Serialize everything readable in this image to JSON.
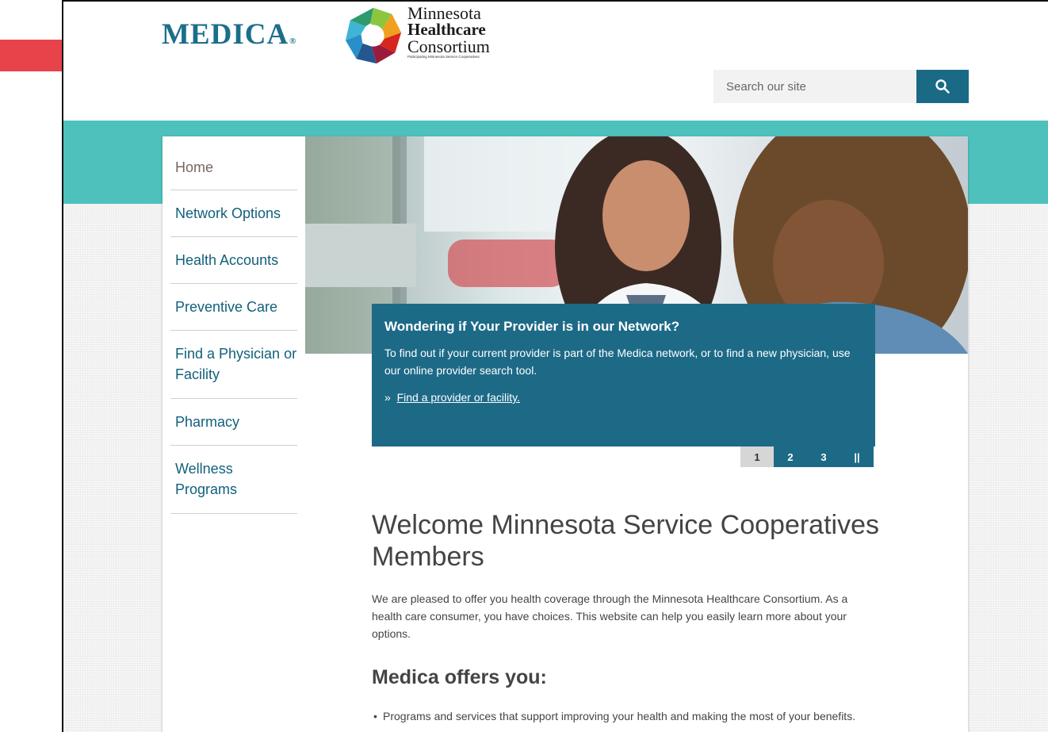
{
  "annotation": {
    "arrow_color": "#e8434a"
  },
  "header": {
    "medica_logo": "MEDICA",
    "medica_logo_mark": "®",
    "partner_logo": {
      "line1": "Minnesota",
      "line2": "Healthcare",
      "line3": "Consortium",
      "tagline": "Participating Minnesota Service Cooperatives"
    },
    "search": {
      "placeholder": "Search our site",
      "button_icon": "search-icon"
    }
  },
  "sidebar": {
    "items": [
      {
        "label": "Home"
      },
      {
        "label": "Network Options"
      },
      {
        "label": "Health Accounts"
      },
      {
        "label": "Preventive Care"
      },
      {
        "label": "Find a Physician or Facility"
      },
      {
        "label": "Pharmacy"
      },
      {
        "label": "Wellness Programs"
      }
    ]
  },
  "hero": {
    "callout_title": "Wondering if Your Provider is in our Network?",
    "callout_body": "To find out if your current provider is part of the Medica network, or to find a new physician, use our online provider search tool.",
    "callout_link_prefix": "»",
    "callout_link": "Find a provider or facility."
  },
  "pager": {
    "pages": [
      "1",
      "2",
      "3"
    ],
    "active": "1",
    "pause_label": "||"
  },
  "main": {
    "title": "Welcome Minnesota Service Cooperatives Members",
    "intro": "We are pleased to offer you health coverage through the Minnesota Healthcare Consortium. As a health care consumer, you have choices. This website can help you easily learn more about your options.",
    "offers_title": "Medica offers you:",
    "offers": [
      "Programs and services that support improving your health and making the most of your benefits."
    ]
  },
  "colors": {
    "brand_teal": "#4fc1bd",
    "brand_blue": "#1d6a87",
    "nav_text": "#12607c"
  }
}
